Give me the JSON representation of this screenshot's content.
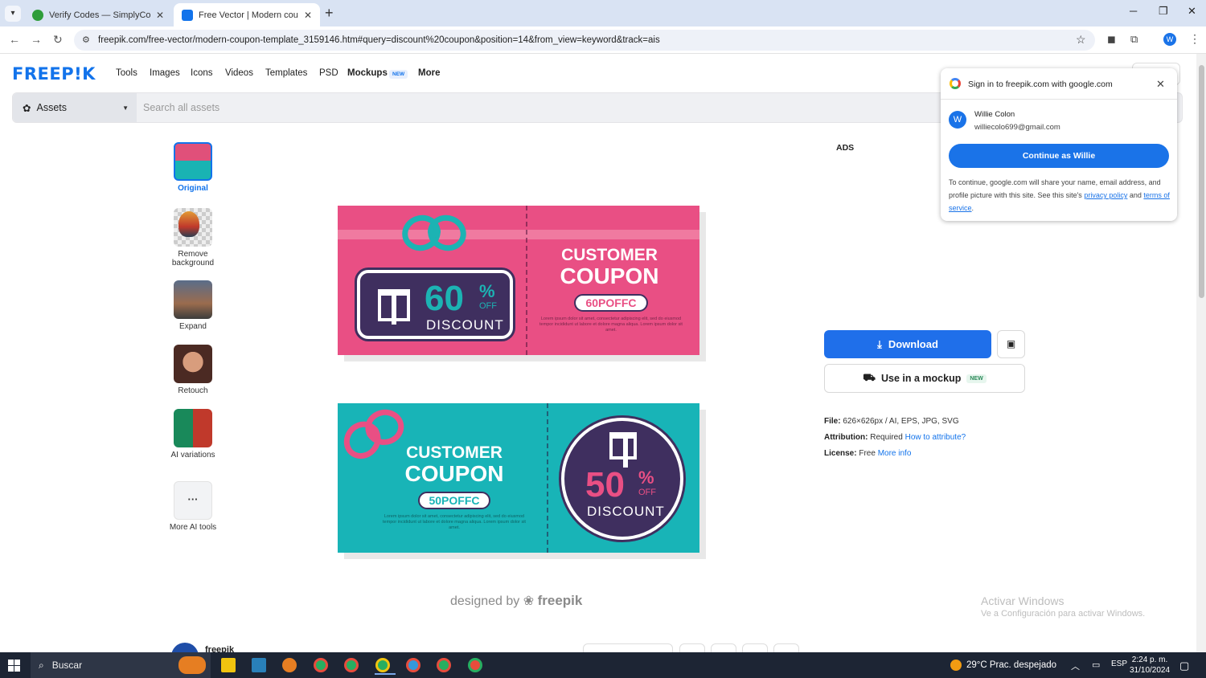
{
  "browser": {
    "tabs": [
      {
        "title": "Verify Codes — SimplyCodes",
        "active": false
      },
      {
        "title": "Free Vector | Modern coupon te",
        "active": true
      }
    ],
    "url": "freepik.com/free-vector/modern-coupon-template_3159146.htm#query=discount%20coupon&position=14&from_view=keyword&track=ais",
    "profile_initial": "W"
  },
  "header": {
    "logo": "FREEP!K",
    "nav": [
      "Tools",
      "Images",
      "Icons",
      "Videos",
      "Templates",
      "PSD",
      "Mockups",
      "More"
    ],
    "mockups_badge": "NEW"
  },
  "search": {
    "asset_type": "Assets",
    "placeholder": "Search all assets"
  },
  "tools": [
    {
      "label": "Original"
    },
    {
      "label": "Remove background"
    },
    {
      "label": "Expand"
    },
    {
      "label": "Retouch"
    },
    {
      "label": "AI variations"
    },
    {
      "label": "More AI tools"
    }
  ],
  "coupon_pink": {
    "percent": "60",
    "percent_sign": "%",
    "off": "OFF",
    "discount": "DISCOUNT",
    "heading1": "CUSTOMER",
    "heading2": "COUPON",
    "code": "60POFFC",
    "lorem": "Lorem ipsum dolor sit amet, consectetur adipiscing elit, sed do eiusmod tempor incididunt ut labore et dolore magna aliqua. Lorem ipsum dolor sit amet."
  },
  "coupon_teal": {
    "percent": "50",
    "percent_sign": "%",
    "off": "OFF",
    "discount": "DISCOUNT",
    "heading1": "CUSTOMER",
    "heading2": "COUPON",
    "code": "50POFFC",
    "lorem": "Lorem ipsum dolor sit amet, consectetur adipiscing elit, sed do eiusmod tempor incididunt ut labore et dolore magna aliqua. Lorem ipsum dolor sit amet."
  },
  "designed_by": {
    "prefix": "designed by",
    "brand": "freepik"
  },
  "ads_label": "ADS",
  "actions": {
    "download": "Download",
    "mockup": "Use in a mockup",
    "mockup_badge": "NEW"
  },
  "file_info": {
    "file_label": "File:",
    "file_value": "626×626px / AI, EPS, JPG, SVG",
    "attribution_label": "Attribution:",
    "attribution_value": "Required",
    "attribution_link": "How to attribute?",
    "license_label": "License:",
    "license_value": "Free",
    "license_link": "More info"
  },
  "google_popup": {
    "title": "Sign in to freepik.com with google.com",
    "avatar_initial": "W",
    "name": "Willie Colon",
    "email": "williecolo699@gmail.com",
    "continue": "Continue as Willie",
    "note_prefix": "To continue, google.com will share your name, email address, and profile picture with this site. See this site's",
    "privacy": "privacy policy",
    "and": "and",
    "terms": "terms of service",
    "period": "."
  },
  "author": {
    "name": "freepik"
  },
  "windows": {
    "activate_title": "Activar Windows",
    "activate_sub": "Ve a Configuración para activar Windows."
  },
  "taskbar": {
    "search": "Buscar",
    "weather": "29°C  Prac. despejado",
    "lang": "ESP",
    "time": "2:24 p. m.",
    "date": "31/10/2024"
  },
  "colors": {
    "brand": "#1273eb",
    "coupon_pink": "#e94f84",
    "coupon_teal": "#18b4b7",
    "coupon_navy": "#3f2f5f",
    "google_blue": "#1a73e8"
  }
}
